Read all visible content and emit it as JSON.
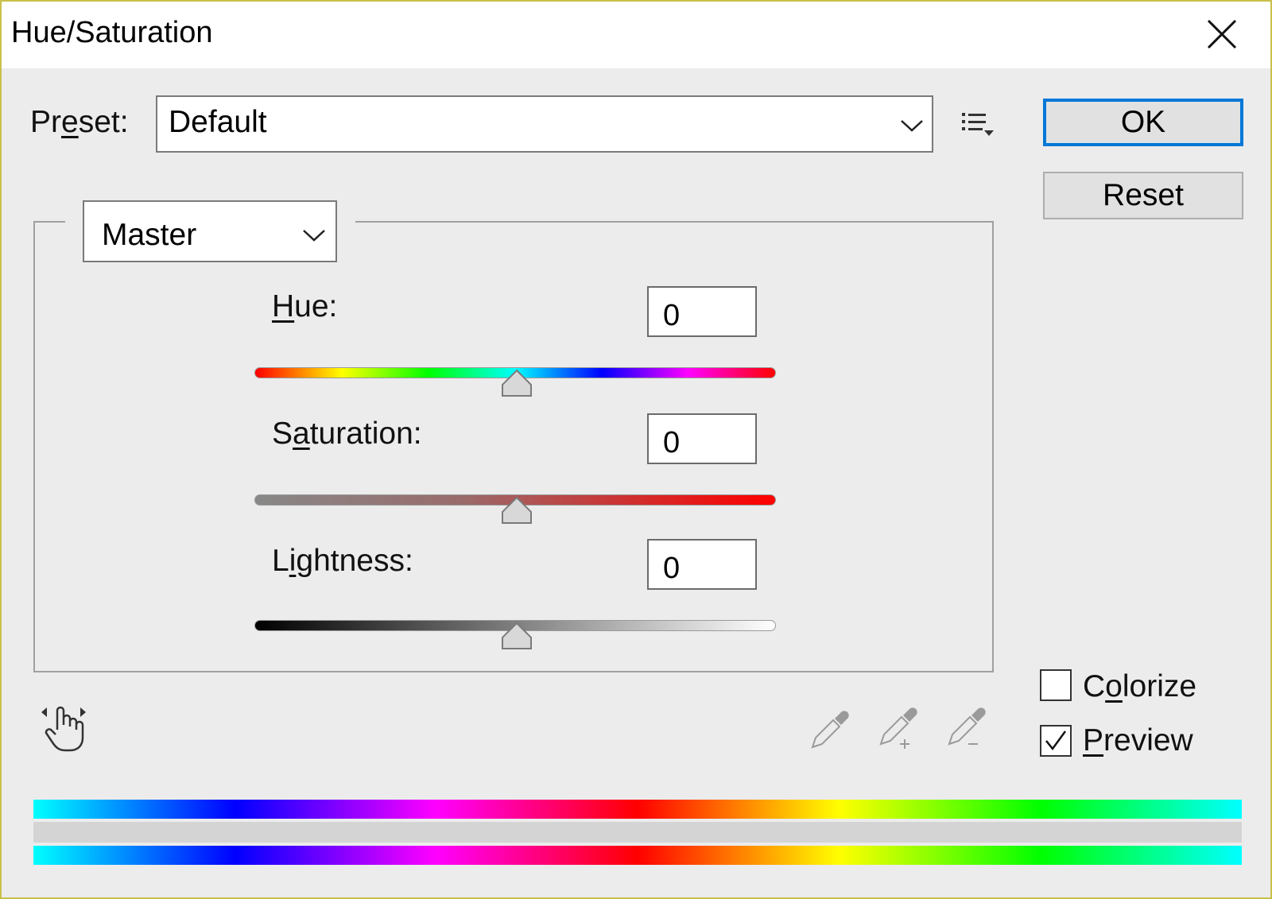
{
  "window": {
    "title": "Hue/Saturation"
  },
  "preset": {
    "label_pre": "Pr",
    "label_u": "e",
    "label_post": "set:",
    "value": "Default"
  },
  "buttons": {
    "ok": "OK",
    "reset": "Reset"
  },
  "channel": {
    "value": "Master"
  },
  "sliders": {
    "hue": {
      "label_u": "H",
      "label_post": "ue:",
      "value": "0",
      "position": 0.5
    },
    "saturation": {
      "label_pre": "S",
      "label_u": "a",
      "label_post": "turation:",
      "value": "0",
      "position": 0.5
    },
    "lightness": {
      "label_pre": "L",
      "label_u": "i",
      "label_post": "ghtness:",
      "value": "0",
      "position": 0.5
    }
  },
  "options": {
    "colorize": {
      "label_pre": "C",
      "label_u": "o",
      "label_post": "lorize",
      "checked": false
    },
    "preview": {
      "label_u": "P",
      "label_post": "review",
      "checked": true
    }
  },
  "icons": {
    "close": "close-icon",
    "preset_menu": "preset-options-icon",
    "targeted_adjust": "targeted-adjustment-hand-icon",
    "eyedropper": "eyedropper-icon",
    "eyedropper_add": "eyedropper-add-icon",
    "eyedropper_subtract": "eyedropper-subtract-icon"
  },
  "colors": {
    "accent": "#0078d7",
    "border": "#c9c04a"
  }
}
